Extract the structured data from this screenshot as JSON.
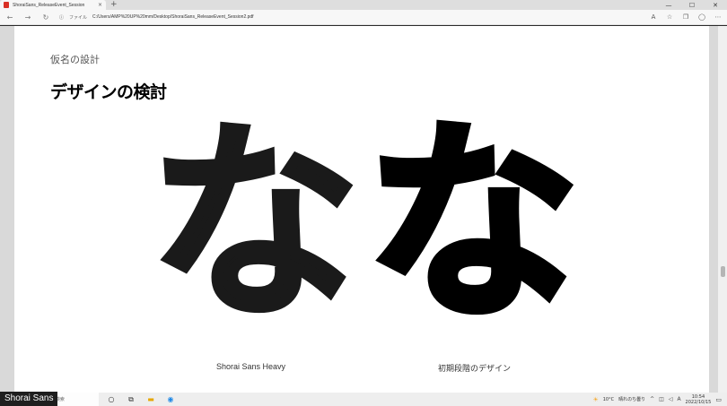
{
  "browser": {
    "tab_title": "ShoraiSans_ReleaseEvent_Session",
    "tab_close": "×",
    "new_tab": "+",
    "window_controls": [
      "—",
      "☐",
      "✕"
    ],
    "address": {
      "scheme_label": "ファイル",
      "url": "C:/Users/AMP%20UP%20mm/Desktop/ShoraiSans_ReleaseEvent_Session2.pdf"
    },
    "nav_icons": [
      "back-icon",
      "forward-icon",
      "reload-icon"
    ],
    "toolbar_icons": [
      "read-aloud-icon",
      "favorite-icon",
      "collections-icon",
      "profile-icon",
      "more-icon"
    ]
  },
  "slide": {
    "section_label": "仮名の設計",
    "title": "デザインの検討",
    "glyph_left": "な",
    "glyph_right": "な",
    "caption_left": "Shorai Sans Heavy",
    "caption_right": "初期段階のデザイン"
  },
  "taskbar": {
    "search_placeholder": "して検索",
    "weather_text": "10°C　晴れのち曇り",
    "clock_time": "10:54",
    "clock_date": "2022/10/15"
  },
  "overlay": {
    "label": "Shorai Sans"
  },
  "colors": {
    "page_bg": "#ffffff",
    "viewer_bg": "#d9d9d9",
    "glyph_left": "#1a1a1a",
    "glyph_right": "#000000",
    "pdf_favicon": "#d93025"
  }
}
